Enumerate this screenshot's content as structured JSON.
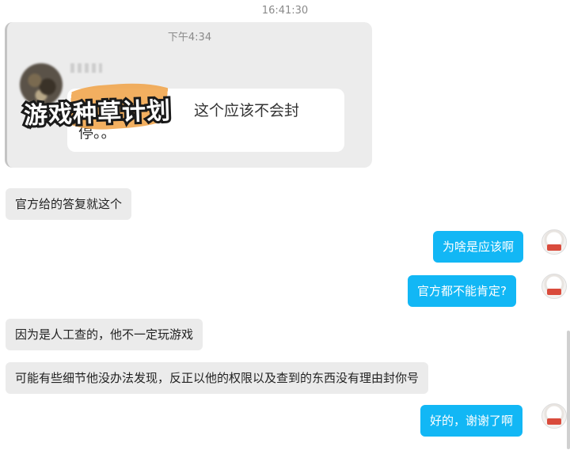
{
  "chat": {
    "top_timestamp": "16:41:30",
    "quoted": {
      "time": "下午4:34",
      "text": "这个应该不会封停。。",
      "sticker_title": "游戏种草计划"
    },
    "messages": [
      {
        "side": "left",
        "text": "官方给的答复就这个"
      },
      {
        "side": "right",
        "text": "为啥是应该啊"
      },
      {
        "side": "right",
        "text": "官方都不能肯定?"
      },
      {
        "side": "left",
        "text": "因为是人工查的，他不一定玩游戏"
      },
      {
        "side": "left",
        "text": "可能有些细节他没办法发现，反正以他的权限以及查到的东西没有理由封你号"
      },
      {
        "side": "right",
        "text": "好的，谢谢了啊"
      }
    ]
  },
  "colors": {
    "self_bubble": "#12b7f5",
    "other_bubble": "#ebebeb",
    "quote_card": "#ececec"
  }
}
